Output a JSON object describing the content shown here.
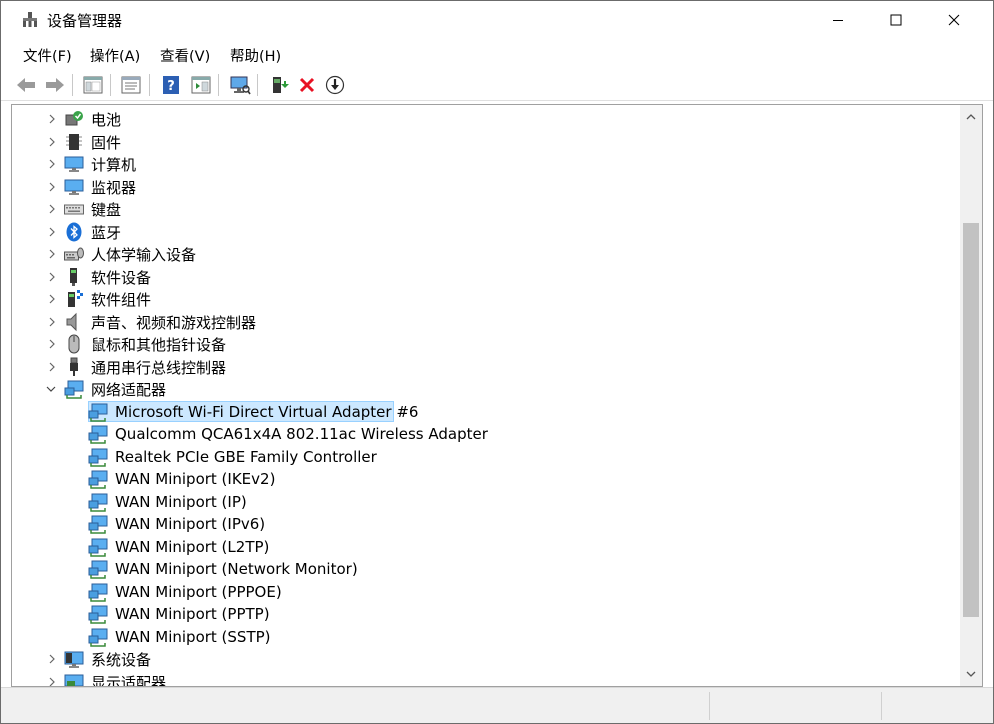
{
  "window": {
    "title": "设备管理器"
  },
  "menu": {
    "items": [
      "文件(F)",
      "操作(A)",
      "查看(V)",
      "帮助(H)"
    ]
  },
  "tree": {
    "categories": [
      {
        "label": "电池",
        "icon": "battery-icon"
      },
      {
        "label": "固件",
        "icon": "firmware-chip-icon"
      },
      {
        "label": "计算机",
        "icon": "computer-icon"
      },
      {
        "label": "监视器",
        "icon": "monitor-icon"
      },
      {
        "label": "键盘",
        "icon": "keyboard-icon"
      },
      {
        "label": "蓝牙",
        "icon": "bluetooth-icon"
      },
      {
        "label": "人体学输入设备",
        "icon": "hid-icon"
      },
      {
        "label": "软件设备",
        "icon": "software-device-icon"
      },
      {
        "label": "软件组件",
        "icon": "software-component-icon"
      },
      {
        "label": "声音、视频和游戏控制器",
        "icon": "speaker-icon"
      },
      {
        "label": "鼠标和其他指针设备",
        "icon": "mouse-icon"
      },
      {
        "label": "通用串行总线控制器",
        "icon": "usb-icon"
      },
      {
        "label": "网络适配器",
        "icon": "network-adapter-icon",
        "expanded": true
      }
    ],
    "network_adapters": [
      "Microsoft Wi-Fi Direct Virtual Adapter #6",
      "Qualcomm QCA61x4A 802.11ac Wireless Adapter",
      "Realtek PCIe GBE Family Controller",
      "WAN Miniport (IKEv2)",
      "WAN Miniport (IP)",
      "WAN Miniport (IPv6)",
      "WAN Miniport (L2TP)",
      "WAN Miniport (Network Monitor)",
      "WAN Miniport (PPPOE)",
      "WAN Miniport (PPTP)",
      "WAN Miniport (SSTP)"
    ],
    "selected_adapter": "Microsoft Wi-Fi Direct Virtual Adapter #6",
    "after_categories": [
      {
        "label": "系统设备",
        "icon": "system-device-icon"
      },
      {
        "label": "显示适配器",
        "icon": "display-adapter-icon"
      }
    ]
  },
  "colors": {
    "selection_bg": "#cce8ff",
    "accent_blue": "#2c72c7",
    "delete_red": "#e81123"
  }
}
